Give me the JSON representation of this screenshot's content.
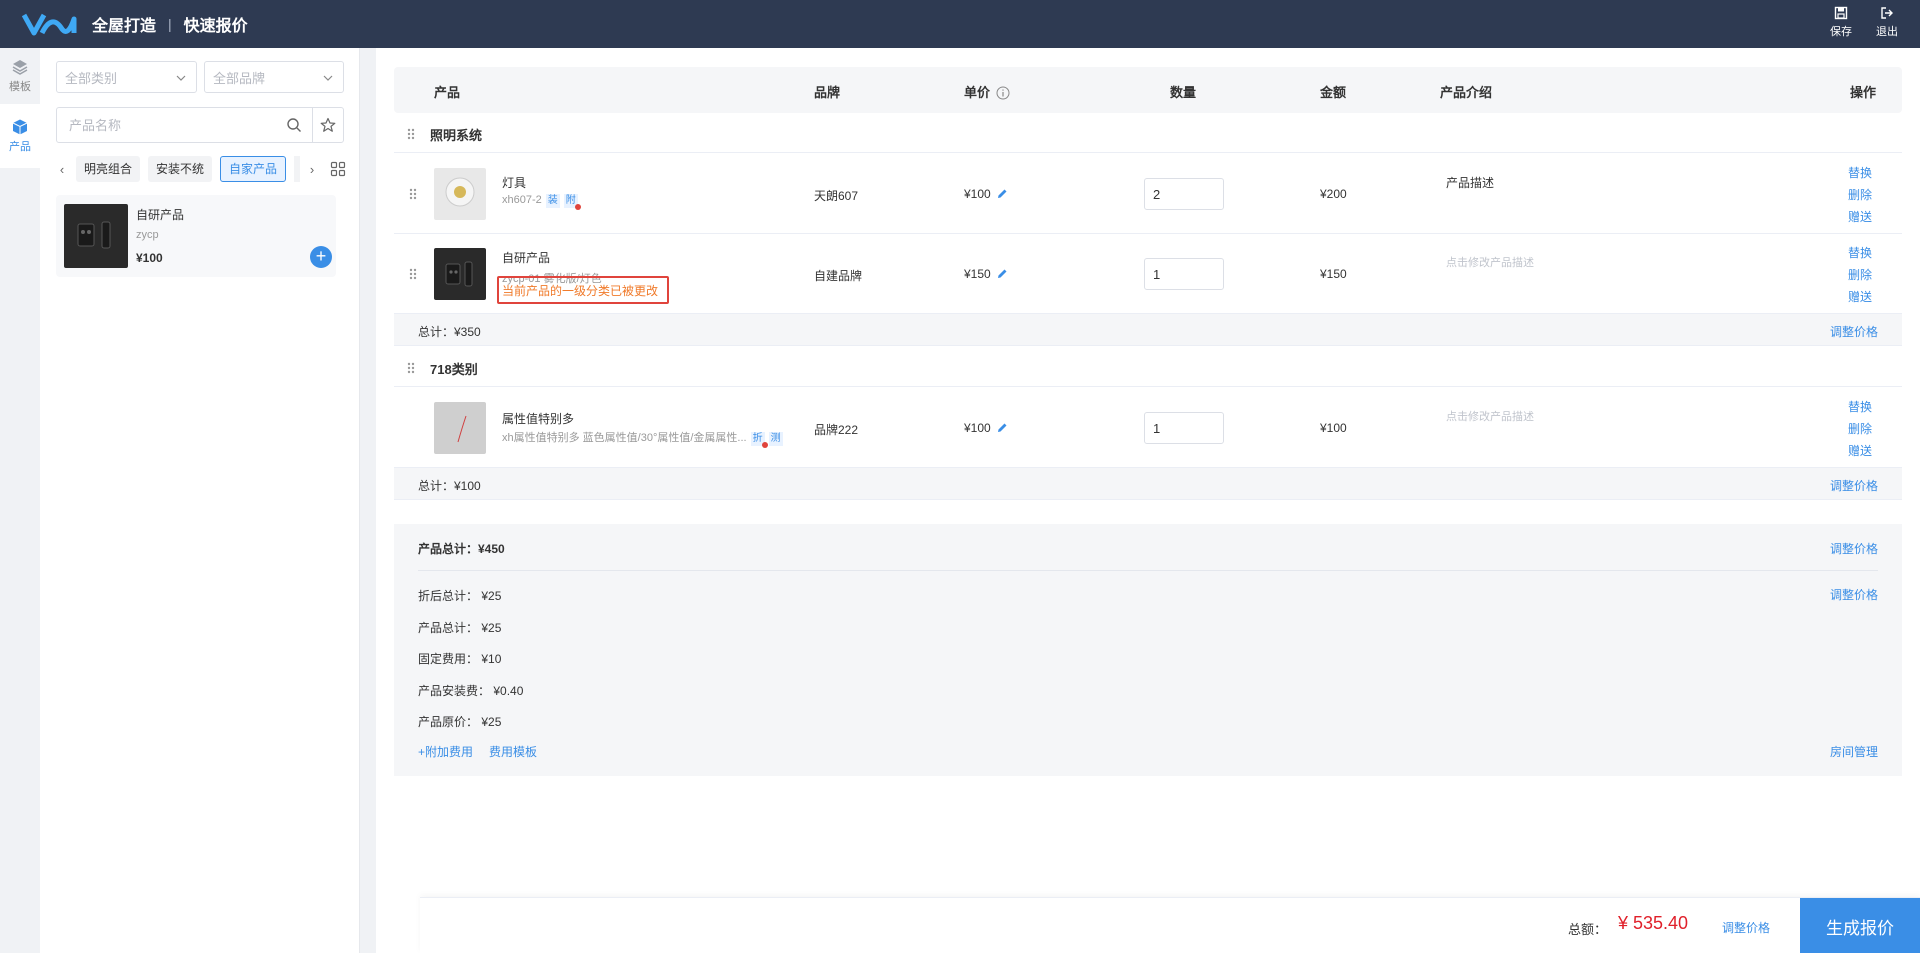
{
  "header": {
    "app_title": "全屋打造",
    "separator": "|",
    "page_title": "快速报价",
    "save_label": "保存",
    "exit_label": "退出"
  },
  "rail": {
    "template_label": "模板",
    "product_label": "产品"
  },
  "filters": {
    "category_placeholder": "全部类别",
    "brand_placeholder": "全部品牌",
    "search_placeholder": "产品名称"
  },
  "tags": [
    "明亮组合",
    "安装不统",
    "自家产品"
  ],
  "catalog": [
    {
      "name": "自研产品",
      "code": "zycp",
      "price": "¥100"
    }
  ],
  "table": {
    "headers": {
      "product": "产品",
      "brand": "品牌",
      "unit_price": "单价",
      "quantity": "数量",
      "amount": "金额",
      "description": "产品介绍",
      "actions": "操作"
    }
  },
  "groups": [
    {
      "name": "照明系统",
      "rows": [
        {
          "name": "灯具",
          "code": "xh607-2",
          "badges": [
            "装",
            "附"
          ],
          "brand": "天朗607",
          "price": "¥100",
          "qty": "2",
          "amount": "¥200",
          "desc": "产品描述",
          "desc_placeholder": false
        },
        {
          "name": "自研产品",
          "code": "zycp-01 雾化版/灯色",
          "badges": [],
          "brand": "自建品牌",
          "price": "¥150",
          "qty": "1",
          "amount": "¥150",
          "desc": "点击修改产品描述",
          "desc_placeholder": true,
          "warning": "当前产品的一级分类已被更改"
        }
      ],
      "subtotal": "总计：¥350"
    },
    {
      "name": "718类别",
      "rows": [
        {
          "name": "属性值特别多",
          "code": "xh属性值特别多 蓝色属性值/30°属性值/金属属性...",
          "badges": [
            "折",
            "测"
          ],
          "brand": "品牌222",
          "price": "¥100",
          "qty": "1",
          "amount": "¥100",
          "desc": "点击修改产品描述",
          "desc_placeholder": true
        }
      ],
      "subtotal": "总计：¥100"
    }
  ],
  "row_actions": {
    "replace": "替换",
    "delete": "删除",
    "gift": "赠送"
  },
  "adjust_price": "调整价格",
  "summary": {
    "title": "产品总计：¥450",
    "items": [
      {
        "label": "折后总计：",
        "value": "¥25"
      },
      {
        "label": "产品总计：",
        "value": "¥25"
      },
      {
        "label": "固定费用：",
        "value": "¥10"
      },
      {
        "label": "产品安装费：",
        "value": "¥0.40"
      },
      {
        "label": "产品原价：",
        "value": "¥25"
      }
    ],
    "add_fee": "+附加费用",
    "fee_template": "费用模板",
    "room_manage": "房间管理"
  },
  "footer": {
    "total_label": "总额：",
    "total_value": "¥ 535.40",
    "adjust": "调整价格",
    "generate": "生成报价"
  },
  "colors": {
    "header_bg": "#2e3a52",
    "accent": "#3a8ee6",
    "danger": "#e0202a",
    "warning": "#f07a2a"
  }
}
